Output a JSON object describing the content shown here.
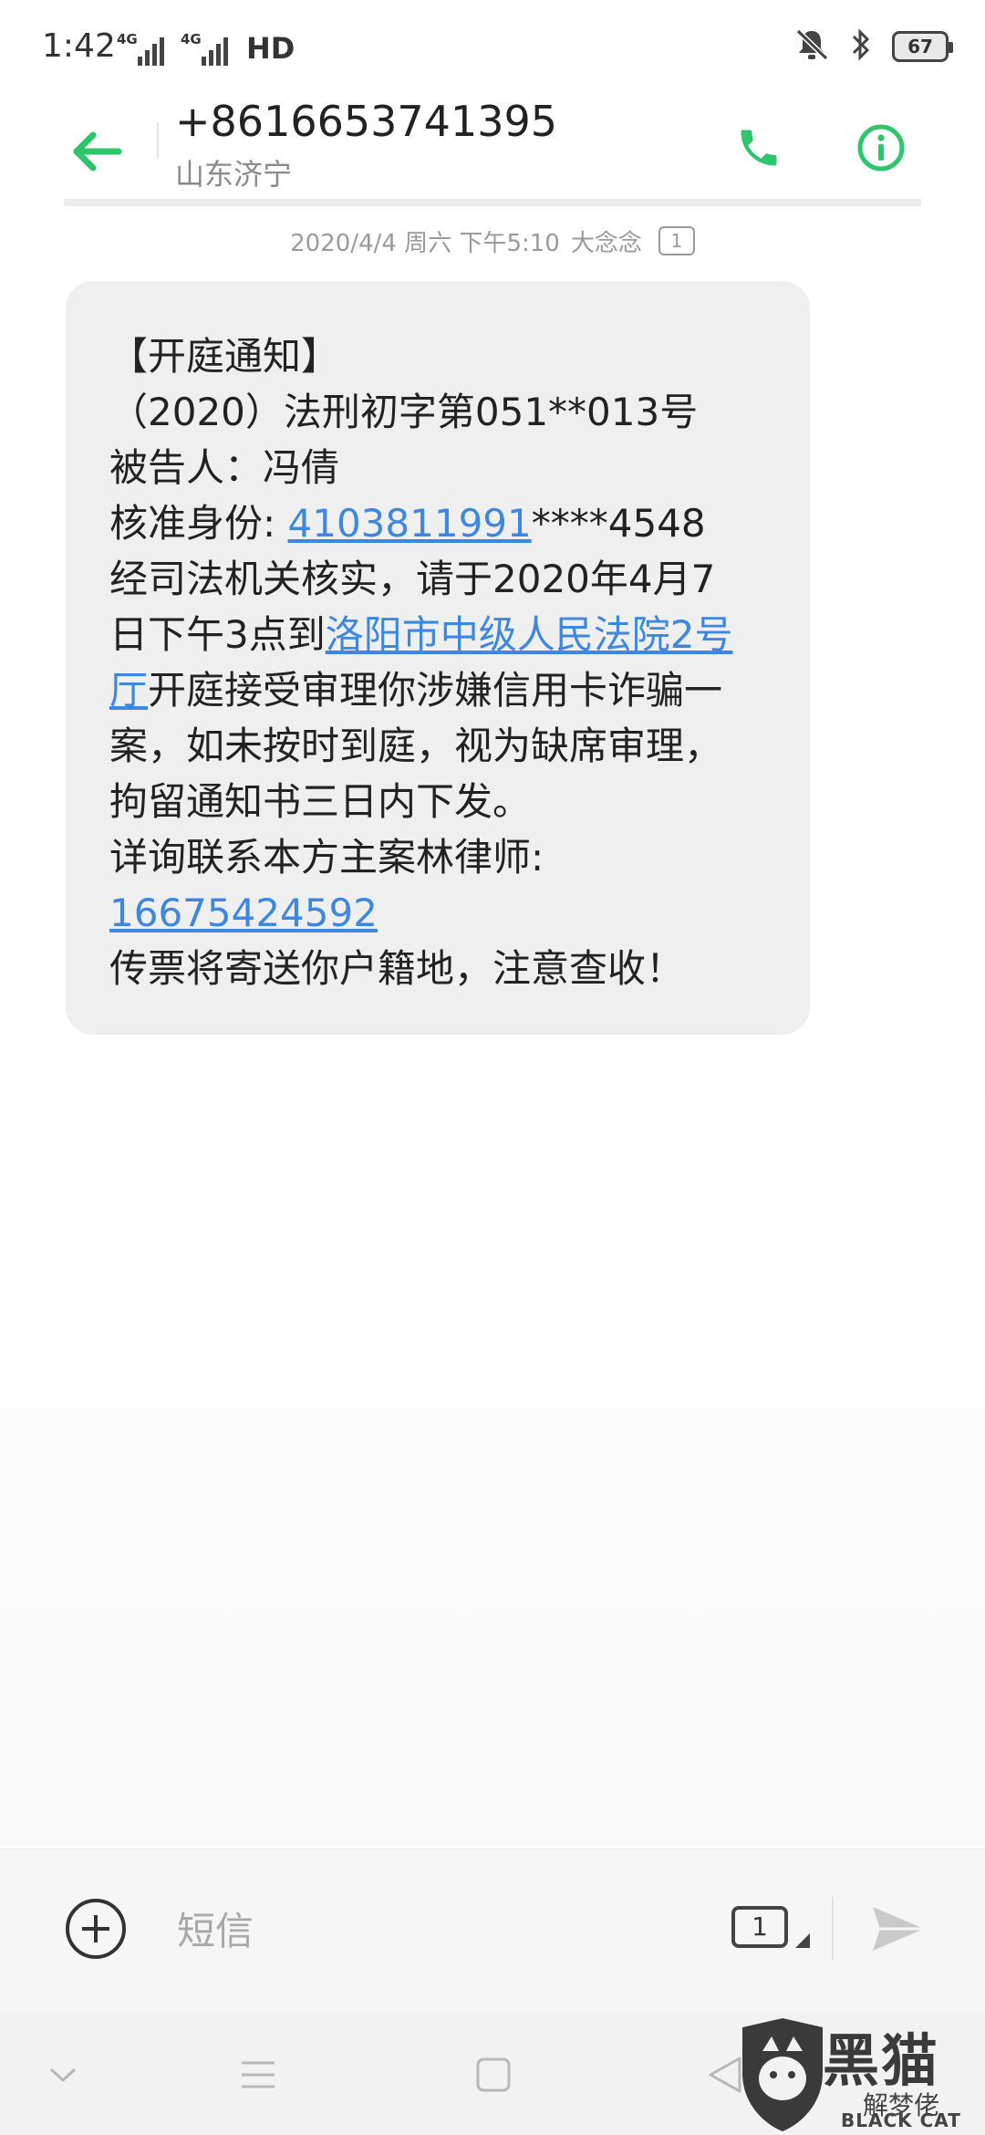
{
  "status_bar": {
    "time": "1:42",
    "sim1_network": "4G",
    "sim2_network": "4G",
    "hd_label": "HD",
    "battery_level": "67",
    "icons": [
      "mute-vibrate-icon",
      "bluetooth-icon",
      "battery-icon"
    ]
  },
  "header": {
    "number": "+8616653741395",
    "location": "山东济宁",
    "accent_color": "#2fc56a"
  },
  "conversation": {
    "date": "2020/4/4 周六 下午5:10",
    "carrier": "大念念",
    "sim_slot": "1"
  },
  "message": {
    "l1": "【开庭通知】",
    "l2": "（2020）法刑初字第051**013号",
    "l3": "被告人：冯倩",
    "l4_label": "核准身份: ",
    "l4_link": "4103811991",
    "l4_rest": "****4548",
    "l5": "经司法机关核实，请于2020年4月7",
    "l6_pre": "日下午3点到",
    "l6_link": "洛阳市中级人民法院2号",
    "l7_link": "厅",
    "l7_rest": "开庭接受审理你涉嫌信用卡诈骗一",
    "l8": "案，如未按时到庭，视为缺席审理，",
    "l9": "拘留通知书三日内下发。",
    "l10": "详询联系本方主案林律师:",
    "l11_link": "16675424592",
    "l12": "传票将寄送你户籍地，注意查收！",
    "link_color": "#3d87e0"
  },
  "compose": {
    "placeholder": "短信",
    "value": "",
    "sim_slot": "1"
  },
  "watermark": {
    "main": "黑猫",
    "sub": "解梦佬",
    "latin": "BLACK CAT"
  }
}
